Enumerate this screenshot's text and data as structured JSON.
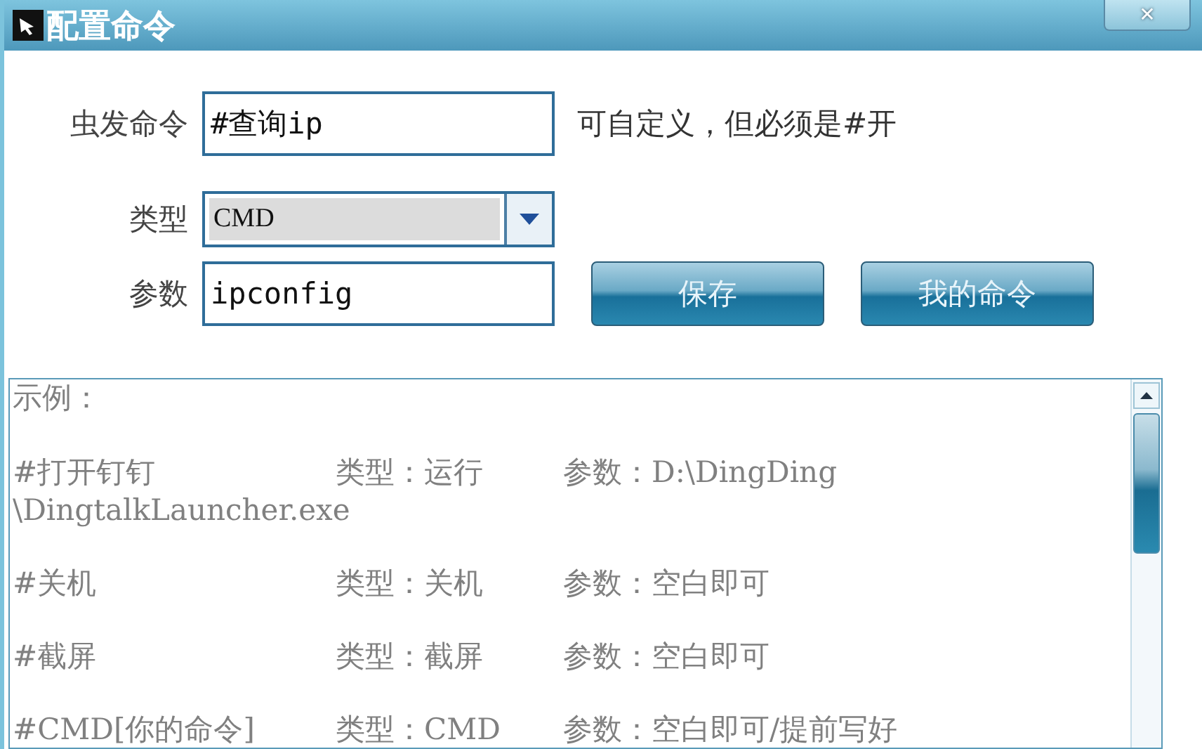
{
  "window": {
    "title": "配置命令",
    "close": "✕"
  },
  "form": {
    "trigger": {
      "label": "虫发命令",
      "value": "#查询ip",
      "hint": "可自定义，但必须是#开"
    },
    "type": {
      "label": "类型",
      "value": "CMD"
    },
    "param": {
      "label": "参数",
      "value": "ipconfig"
    },
    "buttons": [
      "保存",
      "我的命令"
    ]
  },
  "examples": {
    "heading": "示例：",
    "rows": [
      {
        "name": "#打开钉钉",
        "type": "类型：运行",
        "param": "参数：D:\\DingDing",
        "wrap": "\\DingtalkLauncher.exe"
      },
      {
        "name": "#关机",
        "type": "类型：关机",
        "param": "参数：空白即可"
      },
      {
        "name": "#截屏",
        "type": "类型：截屏",
        "param": "参数：空白即可"
      },
      {
        "name": "#CMD[你的命令]",
        "type": "类型：CMD",
        "param": "参数：空白即可/提前写好"
      }
    ]
  }
}
